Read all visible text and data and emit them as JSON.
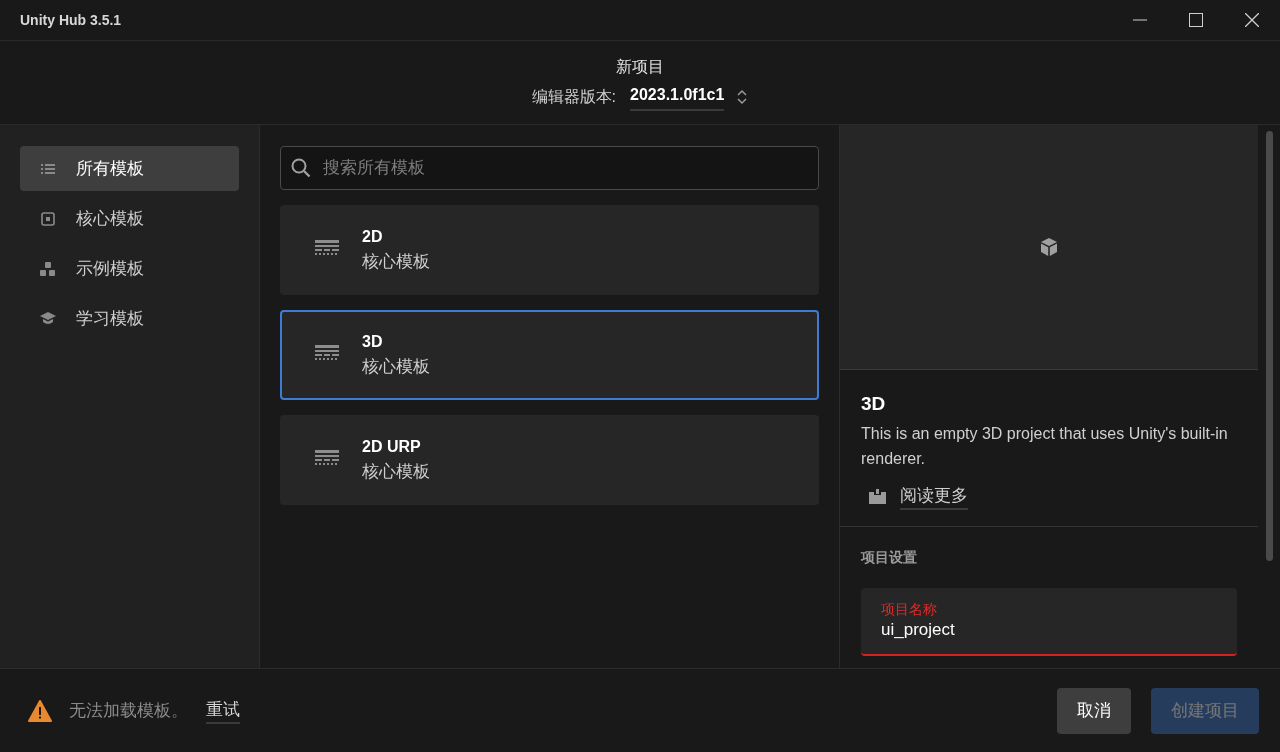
{
  "window": {
    "title": "Unity Hub 3.5.1"
  },
  "header": {
    "title": "新项目",
    "version_label": "编辑器版本:",
    "version": "2023.1.0f1c1"
  },
  "sidebar": {
    "items": [
      {
        "label": "所有模板",
        "kind": "list",
        "selected": true
      },
      {
        "label": "核心模板",
        "kind": "core",
        "selected": false
      },
      {
        "label": "示例模板",
        "kind": "sample",
        "selected": false
      },
      {
        "label": "学习模板",
        "kind": "learn",
        "selected": false
      }
    ]
  },
  "search": {
    "placeholder": "搜索所有模板"
  },
  "templates": [
    {
      "name": "2D",
      "category": "核心模板",
      "selected": false
    },
    {
      "name": "3D",
      "category": "核心模板",
      "selected": true
    },
    {
      "name": "2D URP",
      "category": "核心模板",
      "selected": false
    }
  ],
  "details": {
    "title": "3D",
    "description": "This is an empty 3D project that uses Unity's built-in renderer.",
    "read_more": "阅读更多"
  },
  "settings": {
    "heading": "项目设置",
    "field_label": "项目名称",
    "field_value": "ui_project",
    "invalid": true
  },
  "footer": {
    "warning": "无法加载模板。",
    "retry": "重试",
    "buttons": [
      {
        "label": "取消",
        "kind": "secondary",
        "disabled": false
      },
      {
        "label": "创建项目",
        "kind": "primary",
        "disabled": true
      }
    ]
  }
}
